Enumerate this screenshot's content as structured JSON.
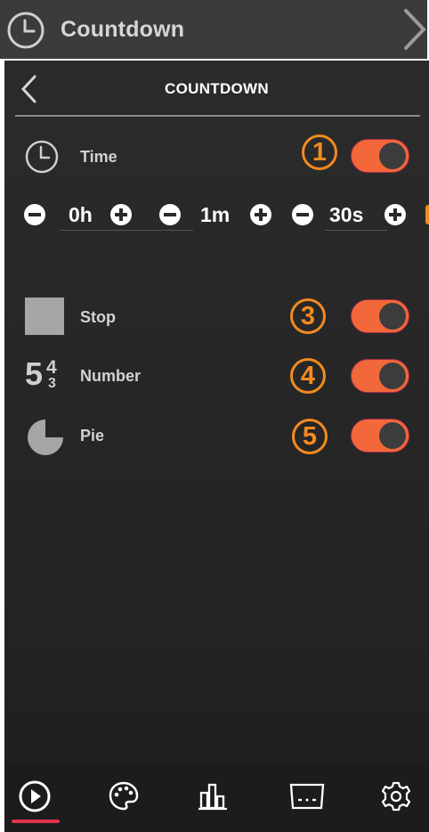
{
  "breadcrumb": {
    "icon": "clock-icon",
    "title": "Countdown",
    "chevron": "chevron-right-icon"
  },
  "header": {
    "back_icon": "chevron-left-icon",
    "title": "COUNTDOWN"
  },
  "time_row": {
    "icon": "clock-icon",
    "label": "Time",
    "badge": "1",
    "enabled": true
  },
  "stepper": {
    "hours": {
      "value": "0h",
      "minus_icon": "minus-circle-icon",
      "plus_icon": "plus-circle-icon"
    },
    "minutes": {
      "value": "1m",
      "minus_icon": "minus-circle-icon",
      "plus_icon": "plus-circle-icon"
    },
    "seconds": {
      "value": "30s",
      "minus_icon": "minus-circle-icon",
      "plus_icon": "plus-circle-icon"
    }
  },
  "options": [
    {
      "icon": "stop-square-icon",
      "label": "Stop",
      "badge": "3",
      "enabled": true
    },
    {
      "icon": "number-countdown-icon",
      "icon_text": {
        "main": "5",
        "top": "4",
        "bottom": "3"
      },
      "label": "Number",
      "badge": "4",
      "enabled": true
    },
    {
      "icon": "pie-icon",
      "label": "Pie",
      "badge": "5",
      "enabled": true
    }
  ],
  "nav": [
    {
      "icon": "play-circle-icon",
      "active": true
    },
    {
      "icon": "palette-icon",
      "active": false
    },
    {
      "icon": "bar-chart-icon",
      "active": false
    },
    {
      "icon": "scoreboard-icon",
      "active": false
    },
    {
      "icon": "gear-icon",
      "active": false
    }
  ],
  "colors": {
    "accent": "#f2683a",
    "badge": "#f28a21",
    "active_underline": "#e0344a",
    "background": "#272727"
  }
}
